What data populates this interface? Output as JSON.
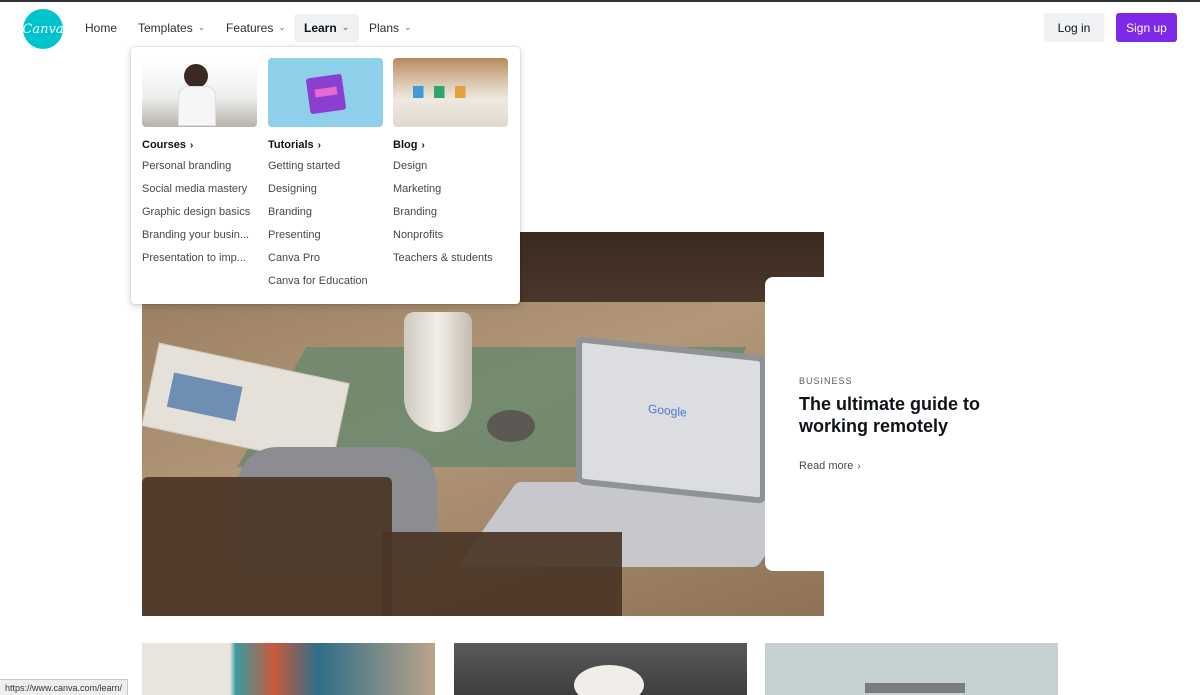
{
  "nav": {
    "logo_text": "Canva",
    "items": [
      {
        "label": "Home"
      },
      {
        "label": "Templates"
      },
      {
        "label": "Features"
      },
      {
        "label": "Learn"
      },
      {
        "label": "Plans"
      }
    ],
    "login_label": "Log in",
    "signup_label": "Sign up"
  },
  "learn_menu": {
    "columns": [
      {
        "heading": "Courses",
        "links": [
          "Personal branding",
          "Social media mastery",
          "Graphic design basics",
          "Branding your busin...",
          "Presentation to imp..."
        ]
      },
      {
        "heading": "Tutorials",
        "links": [
          "Getting started",
          "Designing",
          "Branding",
          "Presenting",
          "Canva Pro",
          "Canva for Education"
        ]
      },
      {
        "heading": "Blog",
        "links": [
          "Design",
          "Marketing",
          "Branding",
          "Nonprofits",
          "Teachers & students"
        ]
      }
    ]
  },
  "hero": {
    "kicker": "BUSINESS",
    "title": "The ultimate guide to working remotely",
    "read_more": "Read more"
  },
  "statusbar": {
    "url": "https://www.canva.com/learn/"
  },
  "colors": {
    "brand": "#00c4cc",
    "signup": "#7d2ae8"
  }
}
